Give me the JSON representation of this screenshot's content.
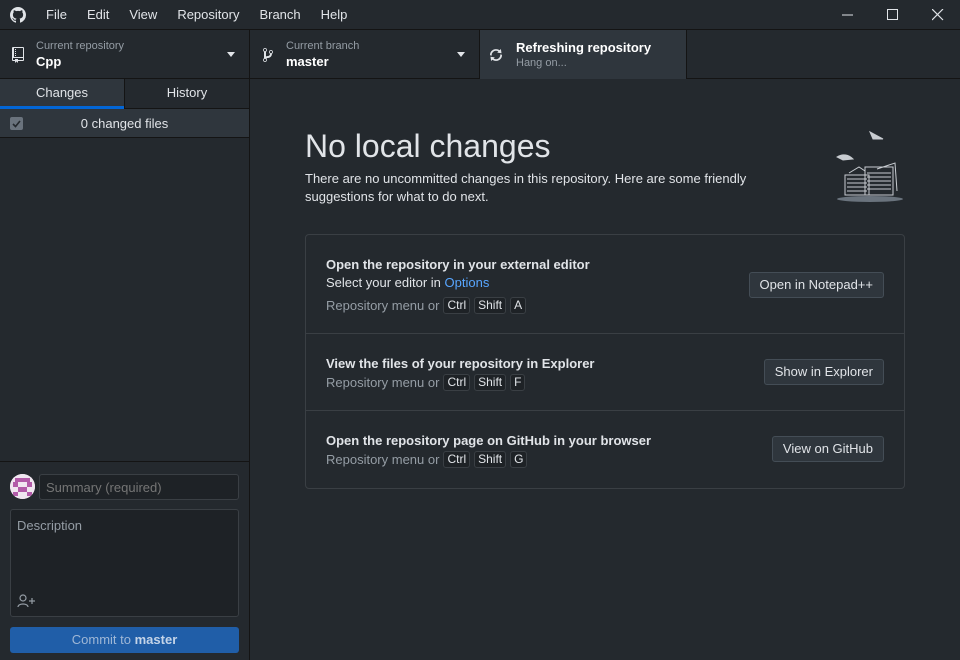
{
  "menu": [
    "File",
    "Edit",
    "View",
    "Repository",
    "Branch",
    "Help"
  ],
  "toolbar": {
    "repo_label": "Current repository",
    "repo_value": "Cpp",
    "branch_label": "Current branch",
    "branch_value": "master",
    "fetch_label": "Refreshing repository",
    "fetch_value": "Hang on..."
  },
  "sidebar": {
    "tabs": [
      "Changes",
      "History"
    ],
    "changed_files": "0 changed files",
    "summary_placeholder": "Summary (required)",
    "description_placeholder": "Description",
    "commit_prefix": "Commit to",
    "commit_branch": "master"
  },
  "main": {
    "title": "No local changes",
    "subtitle": "There are no uncommitted changes in this repository. Here are some friendly suggestions for what to do next.",
    "actions": [
      {
        "title": "Open the repository in your external editor",
        "desc_prefix": "Select your editor in ",
        "desc_link": "Options",
        "shortcut_prefix": "Repository menu or",
        "keys": [
          "Ctrl",
          "Shift",
          "A"
        ],
        "button": "Open in Notepad++"
      },
      {
        "title": "View the files of your repository in Explorer",
        "shortcut_prefix": "Repository menu or",
        "keys": [
          "Ctrl",
          "Shift",
          "F"
        ],
        "button": "Show in Explorer"
      },
      {
        "title": "Open the repository page on GitHub in your browser",
        "shortcut_prefix": "Repository menu or",
        "keys": [
          "Ctrl",
          "Shift",
          "G"
        ],
        "button": "View on GitHub"
      }
    ]
  },
  "colors": {
    "background": "#24292e",
    "accent": "#0366d6",
    "link": "#58a6ff",
    "commit_button": "#205ea8"
  }
}
